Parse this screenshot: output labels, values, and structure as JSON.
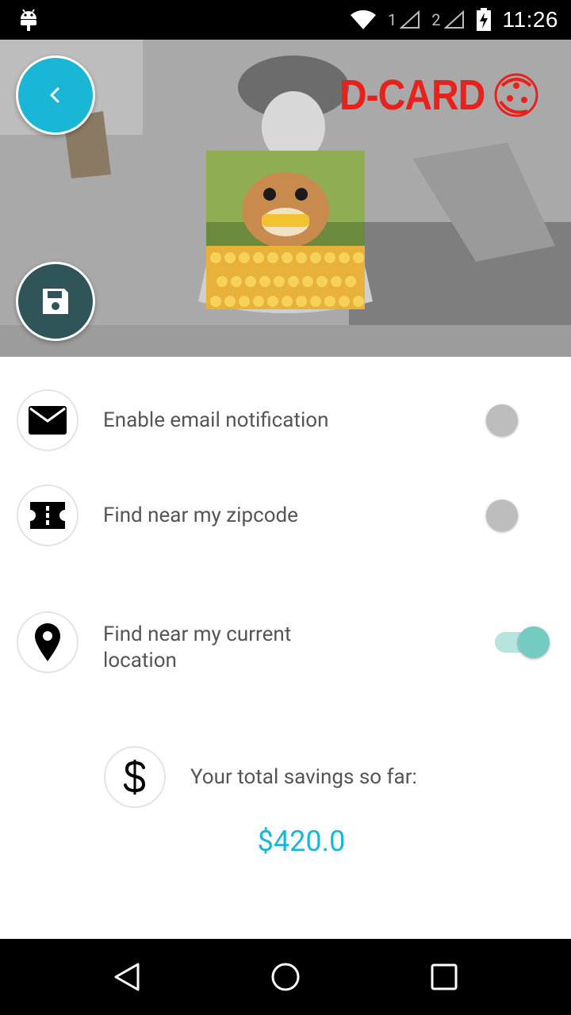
{
  "status_bar": {
    "time": "11:26",
    "sim1": "1",
    "sim2": "2",
    "icons": [
      "android-debug-icon",
      "wifi-icon",
      "signal-icon",
      "battery-charging-icon"
    ]
  },
  "header": {
    "logo_text": "D-CARD",
    "back_icon": "chevron-left-icon",
    "save_icon": "floppy-disk-icon"
  },
  "settings": [
    {
      "label": "Enable email notification",
      "icon": "envelope-icon",
      "enabled": false
    },
    {
      "label": "Find near my zipcode",
      "icon": "ticket-icon",
      "enabled": false
    },
    {
      "label": "Find near my current location",
      "icon": "location-pin-icon",
      "enabled": true
    }
  ],
  "savings": {
    "label": "Your total savings so far:",
    "amount": "$420.0",
    "icon": "dollar-icon"
  },
  "colors": {
    "accent": "#1ab6d6",
    "save_button": "#2f5558",
    "logo_red": "#e8211c",
    "switch_on": "#76cbc1"
  },
  "nav_bar": {
    "icons": [
      "back-triangle-icon",
      "home-circle-icon",
      "recents-square-icon"
    ]
  }
}
